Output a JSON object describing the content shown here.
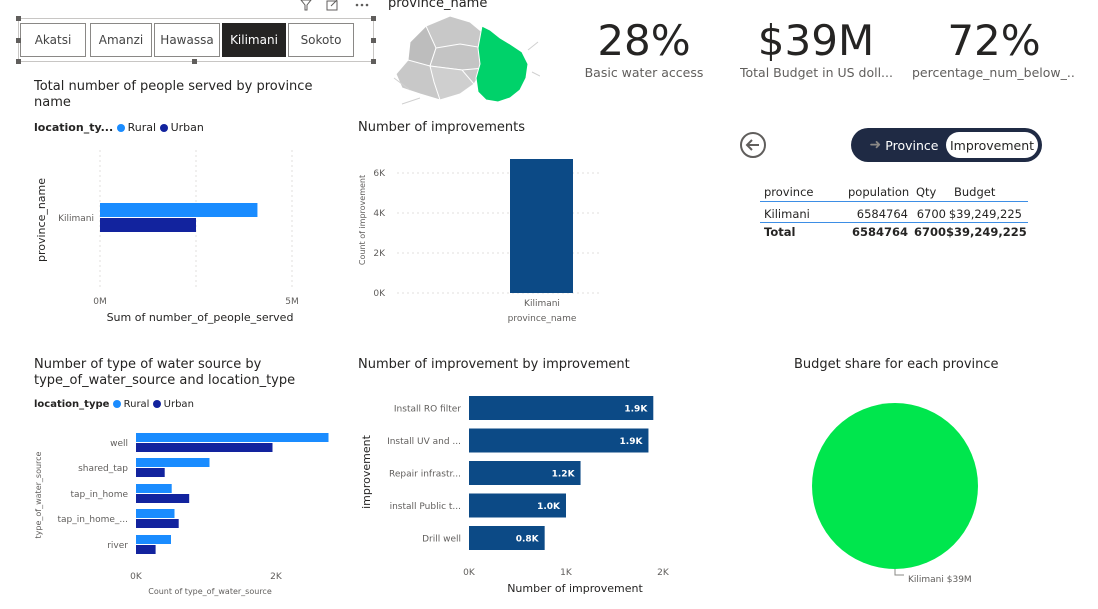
{
  "colors": {
    "rural": "#1a8cff",
    "urban": "#12239e",
    "improvement_bar": "#0a3d7c",
    "map_selected": "#00d26a",
    "map_other": "#c8c8c8",
    "pie": "#00e64d"
  },
  "slicer": {
    "items": [
      "Akatsi",
      "Amanzi",
      "Hawassa",
      "Kilimani",
      "Sokoto"
    ],
    "selected": "Kilimani"
  },
  "map": {
    "title": "province_name"
  },
  "kpis": [
    {
      "value": "28%",
      "label": "Basic water access"
    },
    {
      "value": "$39M",
      "label": "Total Budget in US doll..."
    },
    {
      "value": "72%",
      "label": "percentage_num_below_..."
    }
  ],
  "toggle": {
    "option1": "Province",
    "option2": "Improvement",
    "active": "Improvement"
  },
  "table": {
    "headers": [
      "province",
      "population",
      "Qty",
      "Budget"
    ],
    "rows": [
      [
        "Kilimani",
        "6584764",
        "6700",
        "$39,249,225"
      ]
    ],
    "total": [
      "Total",
      "6584764",
      "6700",
      "$39,249,225"
    ]
  },
  "chart1_title": "Total number of people served by province name",
  "chart2_title": "Number of improvements",
  "chart3_title": "Number of type of water source by type_of_water_source and location_type",
  "chart4_title": "Number of improvement by improvement",
  "chart5_title": "Budget share for each province",
  "chart_data": [
    {
      "type": "bar",
      "orientation": "horizontal",
      "title": "Total number of people served by province name",
      "legend_title": "location_ty...",
      "xlabel": "Sum of number_of_people_served",
      "ylabel": "province_name",
      "categories": [
        "Kilimani"
      ],
      "series": [
        {
          "name": "Rural",
          "values": [
            4100000
          ]
        },
        {
          "name": "Urban",
          "values": [
            2500000
          ]
        }
      ],
      "xlim": [
        0,
        5000000
      ],
      "xticks": [
        "0M",
        "5M"
      ],
      "grid": true,
      "legend": "top-left"
    },
    {
      "type": "bar",
      "title": "Number of improvements",
      "xlabel": "province_name",
      "ylabel": "Count of improvement",
      "categories": [
        "Kilimani"
      ],
      "values": [
        6700
      ],
      "ylim": [
        0,
        7000
      ],
      "yticks": [
        "0K",
        "2K",
        "4K",
        "6K"
      ],
      "grid": true
    },
    {
      "type": "bar",
      "orientation": "horizontal",
      "title": "Number of type of water source by type_of_water_source and location_type",
      "legend_title": "location_type",
      "xlabel": "Count of type_of_water_source",
      "ylabel": "type_of_water_source",
      "categories": [
        "well",
        "shared_tap",
        "tap_in_home",
        "tap_in_home_...",
        "river"
      ],
      "series": [
        {
          "name": "Rural",
          "values": [
            2750,
            1050,
            510,
            550,
            500
          ]
        },
        {
          "name": "Urban",
          "values": [
            1950,
            410,
            760,
            610,
            280
          ]
        }
      ],
      "xlim": [
        0,
        2800
      ],
      "xticks": [
        "0K",
        "2K"
      ],
      "legend": "top-left"
    },
    {
      "type": "bar",
      "orientation": "horizontal",
      "title": "Number of improvement by improvement",
      "xlabel": "Number of improvement",
      "ylabel": "improvement",
      "categories": [
        "Install RO filter",
        "Install UV and ...",
        "Repair infrastr...",
        "install Public t...",
        "Drill well"
      ],
      "values": [
        1900,
        1850,
        1150,
        1000,
        780
      ],
      "data_labels": [
        "1.9K",
        "1.9K",
        "1.2K",
        "1.0K",
        "0.8K"
      ],
      "xlim": [
        0,
        2000
      ],
      "xticks": [
        "0K",
        "1K",
        "2K"
      ]
    },
    {
      "type": "pie",
      "title": "Budget share for each province",
      "slices": [
        {
          "label": "Kilimani",
          "value": 39249225,
          "data_label": "Kilimani $39M"
        }
      ]
    }
  ]
}
